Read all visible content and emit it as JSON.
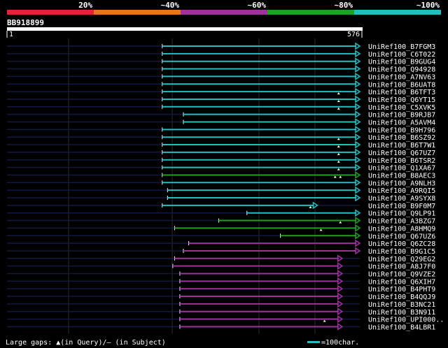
{
  "identity_scale": {
    "labels": [
      "20%",
      "~40%",
      "~60%",
      "~80%",
      "~100%"
    ],
    "colors": [
      "#e8203a",
      "#e07820",
      "#a030a0",
      "#20a020",
      "#20c0c0"
    ]
  },
  "query": {
    "id": "BB918899",
    "start_label": "1",
    "end_label": "576"
  },
  "hits": [
    {
      "id": "UniRef100_B7FGM3",
      "color": "#20c0c0",
      "start": 0.44,
      "end": 1.0,
      "gaps": []
    },
    {
      "id": "UniRef100_C6T022",
      "color": "#20c0c0",
      "start": 0.44,
      "end": 1.0,
      "gaps": []
    },
    {
      "id": "UniRef100_B9GUG4",
      "color": "#20c0c0",
      "start": 0.44,
      "end": 1.0,
      "gaps": []
    },
    {
      "id": "UniRef100_Q94928",
      "color": "#20c0c0",
      "start": 0.44,
      "end": 1.0,
      "gaps": []
    },
    {
      "id": "UniRef100_A7NV63",
      "color": "#20c0c0",
      "start": 0.44,
      "end": 1.0,
      "gaps": []
    },
    {
      "id": "UniRef100_B6UAT8",
      "color": "#20c0c0",
      "start": 0.44,
      "end": 1.0,
      "gaps": []
    },
    {
      "id": "UniRef100_B6TFT3",
      "color": "#20c0c0",
      "start": 0.44,
      "end": 1.0,
      "gaps": [
        0.94
      ]
    },
    {
      "id": "UniRef100_Q6YT15",
      "color": "#20c0c0",
      "start": 0.44,
      "end": 1.0,
      "gaps": [
        0.94
      ]
    },
    {
      "id": "UniRef100_C5XVK5",
      "color": "#20c0c0",
      "start": 0.44,
      "end": 1.0,
      "gaps": [
        0.94
      ]
    },
    {
      "id": "UniRef100_B9RJB7",
      "color": "#20c0c0",
      "start": 0.5,
      "end": 1.0,
      "gaps": []
    },
    {
      "id": "UniRef100_A5AVM4",
      "color": "#20c0c0",
      "start": 0.5,
      "end": 1.0,
      "gaps": []
    },
    {
      "id": "UniRef100_B9H796",
      "color": "#20c0c0",
      "start": 0.44,
      "end": 1.0,
      "gaps": []
    },
    {
      "id": "UniRef100_B6SZ92",
      "color": "#20c0c0",
      "start": 0.44,
      "end": 1.0,
      "gaps": [
        0.94
      ]
    },
    {
      "id": "UniRef100_B6T7W1",
      "color": "#20c0c0",
      "start": 0.44,
      "end": 1.0,
      "gaps": [
        0.94
      ]
    },
    {
      "id": "UniRef100_Q67UZ7",
      "color": "#20c0c0",
      "start": 0.44,
      "end": 1.0,
      "gaps": [
        0.94
      ]
    },
    {
      "id": "UniRef100_B6TSR2",
      "color": "#20c0c0",
      "start": 0.44,
      "end": 1.0,
      "gaps": [
        0.94
      ]
    },
    {
      "id": "UniRef100_Q1XA67",
      "color": "#20c0c0",
      "start": 0.44,
      "end": 1.0,
      "gaps": [
        0.94
      ]
    },
    {
      "id": "UniRef100_B8AEC3",
      "color": "#20a020",
      "start": 0.44,
      "end": 1.0,
      "gaps": [
        0.93,
        0.945
      ]
    },
    {
      "id": "UniRef100_A9NLH3",
      "color": "#20c0c0",
      "start": 0.44,
      "end": 1.0,
      "gaps": []
    },
    {
      "id": "UniRef100_A9RQI5",
      "color": "#20c0c0",
      "start": 0.455,
      "end": 1.0,
      "gaps": []
    },
    {
      "id": "UniRef100_A9SYX8",
      "color": "#20c0c0",
      "start": 0.455,
      "end": 1.0,
      "gaps": []
    },
    {
      "id": "UniRef100_B9F0M7",
      "color": "#20c0c0",
      "start": 0.44,
      "end": 0.88,
      "gaps": [
        0.86
      ]
    },
    {
      "id": "UniRef100_Q9LP91",
      "color": "#20c0c0",
      "start": 0.68,
      "end": 1.0,
      "gaps": []
    },
    {
      "id": "UniRef100_A3BZG7",
      "color": "#20a020",
      "start": 0.6,
      "end": 1.0,
      "gaps": [
        0.945
      ]
    },
    {
      "id": "UniRef100_A8HMQ9",
      "color": "#20a020",
      "start": 0.475,
      "end": 1.0,
      "gaps": [
        0.89
      ]
    },
    {
      "id": "UniRef100_Q67UZ6",
      "color": "#20a020",
      "start": 0.775,
      "end": 1.0,
      "gaps": []
    },
    {
      "id": "UniRef100_Q6ZC28",
      "color": "#a030a0",
      "start": 0.515,
      "end": 1.0,
      "gaps": []
    },
    {
      "id": "UniRef100_B9G1C5",
      "color": "#a030a0",
      "start": 0.5,
      "end": 1.0,
      "gaps": []
    },
    {
      "id": "UniRef100_Q29EG2",
      "color": "#a030a0",
      "start": 0.475,
      "end": 0.95,
      "gaps": []
    },
    {
      "id": "UniRef100_A8J7F0",
      "color": "#a030a0",
      "start": 0.47,
      "end": 0.95,
      "gaps": []
    },
    {
      "id": "UniRef100_Q9VZE2",
      "color": "#a030a0",
      "start": 0.49,
      "end": 0.95,
      "gaps": []
    },
    {
      "id": "UniRef100_Q6XIH7",
      "color": "#a030a0",
      "start": 0.49,
      "end": 0.95,
      "gaps": []
    },
    {
      "id": "UniRef100_B4PHT9",
      "color": "#a030a0",
      "start": 0.49,
      "end": 0.95,
      "gaps": []
    },
    {
      "id": "UniRef100_B4QQJ9",
      "color": "#a030a0",
      "start": 0.49,
      "end": 0.95,
      "gaps": []
    },
    {
      "id": "UniRef100_B3NC21",
      "color": "#a030a0",
      "start": 0.49,
      "end": 0.95,
      "gaps": []
    },
    {
      "id": "UniRef100_B3N911",
      "color": "#a030a0",
      "start": 0.49,
      "end": 0.95,
      "gaps": []
    },
    {
      "id": "UniRef100_UPI000..",
      "color": "#a030a0",
      "start": 0.49,
      "end": 0.95,
      "gaps": [
        0.9
      ]
    },
    {
      "id": "UniRef100_B4LBR1",
      "color": "#a030a0",
      "start": 0.49,
      "end": 0.95,
      "gaps": []
    }
  ],
  "legend": {
    "text": "Large gaps: ▲(in Query)/— (in Subject)",
    "scale_text": "=100char.",
    "scale_color": "#20c0c0"
  }
}
